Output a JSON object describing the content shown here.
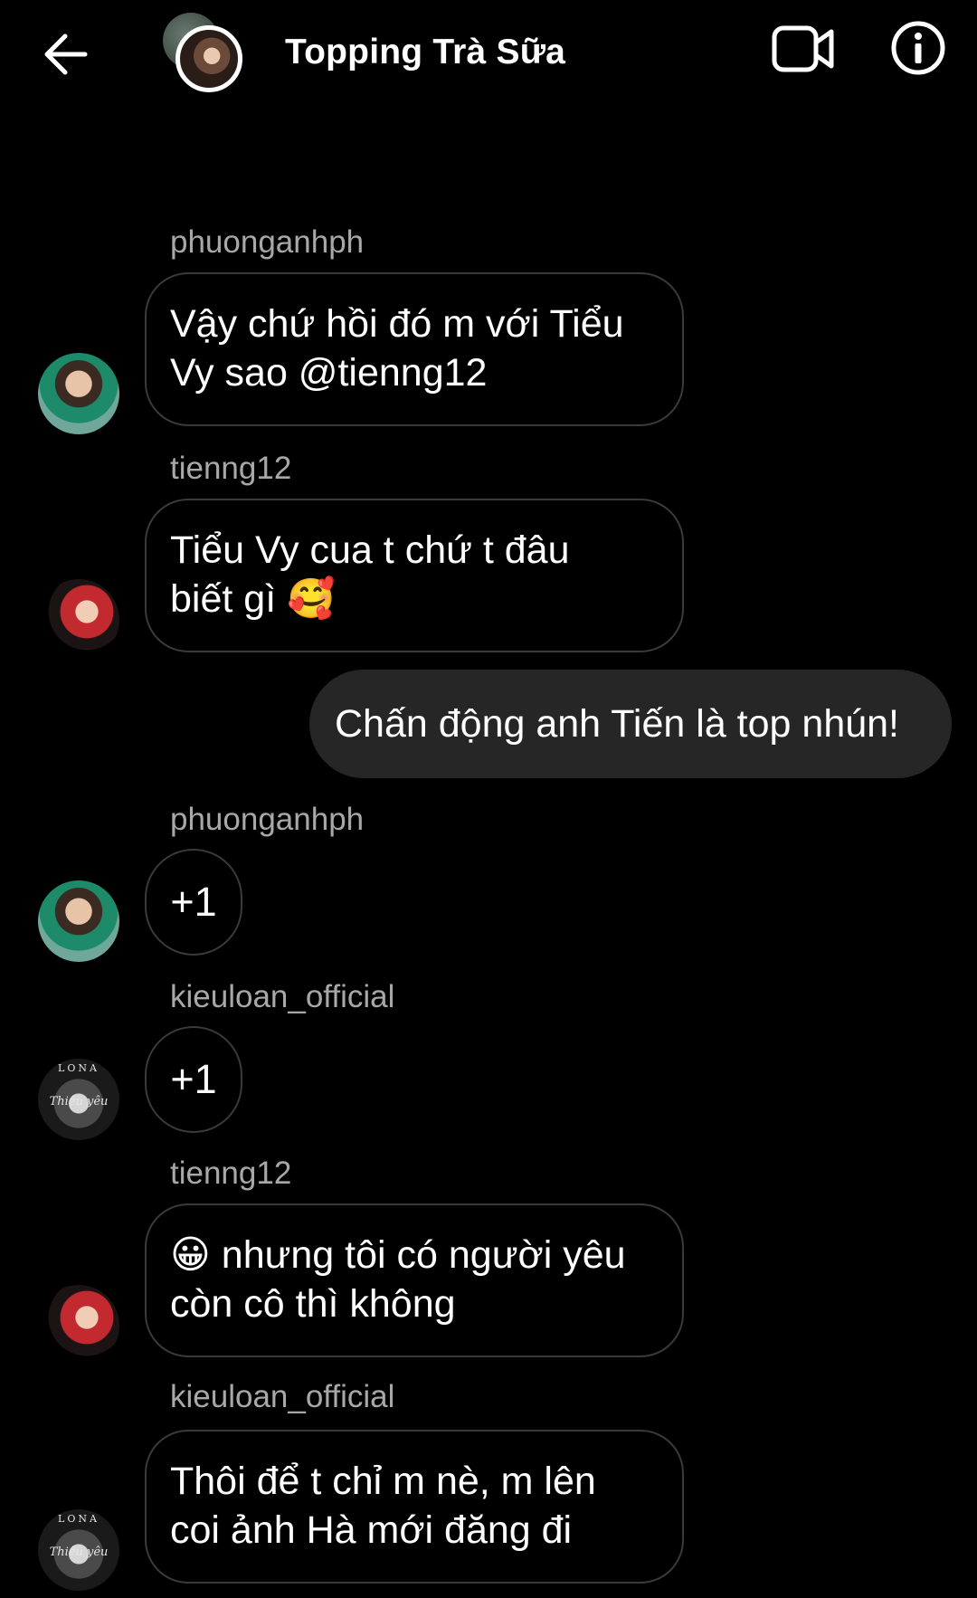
{
  "header": {
    "title": "Topping Trà Sữa",
    "back_icon": "arrow-left-icon",
    "video_icon": "video-camera-icon",
    "info_icon": "info-circle-icon"
  },
  "messages": [
    {
      "sender": "phuonganhph",
      "text": "Vậy chứ hồi đó m với Tiểu\nVy sao @tienng12"
    },
    {
      "sender": "tienng12",
      "text": "Tiểu Vy cua t chứ t đâu\nbiết gì 🥰"
    },
    {
      "sender": "me",
      "text": "Chấn động anh Tiến là top nhún!"
    },
    {
      "sender": "phuonganhph",
      "text": "+1"
    },
    {
      "sender": "kieuloan_official",
      "text": "+1"
    },
    {
      "sender": "tienng12",
      "text": "😀 nhưng tôi có người yêu\ncòn cô thì không"
    },
    {
      "sender": "kieuloan_official",
      "text": "Thôi để t chỉ m nè, m lên\ncoi ảnh Hà mới đăng đi"
    }
  ],
  "avatar_text": {
    "kieuloan_top": "LONA",
    "kieuloan_script": "Thiệu yêu"
  },
  "colors": {
    "background": "#000000",
    "sender_name": "#a8a8a8",
    "outgoing_bubble": "#262626",
    "incoming_border": "#3a3a3a"
  }
}
